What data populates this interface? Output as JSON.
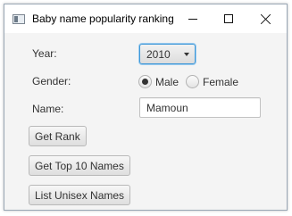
{
  "window": {
    "title": "Baby name popularity ranking"
  },
  "form": {
    "year": {
      "label": "Year:",
      "selected": "2010"
    },
    "gender": {
      "label": "Gender:",
      "options": [
        {
          "label": "Male",
          "checked": true
        },
        {
          "label": "Female",
          "checked": false
        }
      ]
    },
    "name": {
      "label": "Name:",
      "value": "Mamoun"
    }
  },
  "buttons": {
    "get_rank": "Get Rank",
    "get_top10": "Get Top 10 Names",
    "list_unisex": "List Unisex Names"
  },
  "colors": {
    "focus_accent": "#3c97d8",
    "window_background": "#f4f4f4"
  },
  "icons": {
    "app": "app-window-icon",
    "minimize": "minimize-icon",
    "maximize": "maximize-icon",
    "close": "close-icon",
    "dropdown": "chevron-down-icon"
  }
}
